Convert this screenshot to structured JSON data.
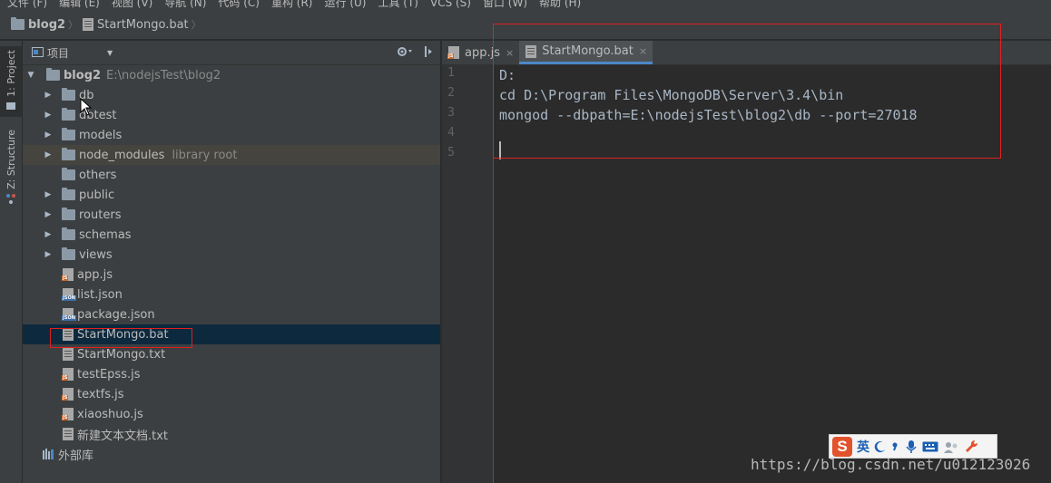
{
  "menu": [
    "文件 (F)",
    "编辑 (E)",
    "视图 (V)",
    "导航 (N)",
    "代码 (C)",
    "重构 (R)",
    "运行 (U)",
    "工具 (T)",
    "VCS (S)",
    "窗口 (W)",
    "帮助 (H)"
  ],
  "breadcrumb": {
    "project": "blog2",
    "file": "StartMongo.bat"
  },
  "side_tabs": {
    "project": "1: Project",
    "structure": "Z: Structure"
  },
  "project_panel": {
    "title": "项目"
  },
  "tree": {
    "root": {
      "name": "blog2",
      "path": "E:\\nodejsTest\\blog2"
    },
    "folders": [
      {
        "name": "db"
      },
      {
        "name": "dbtest"
      },
      {
        "name": "models"
      },
      {
        "name": "node_modules",
        "hint": "library root"
      },
      {
        "name": "others"
      },
      {
        "name": "public"
      },
      {
        "name": "routers"
      },
      {
        "name": "schemas"
      },
      {
        "name": "views"
      }
    ],
    "files": [
      {
        "name": "app.js",
        "type": "js"
      },
      {
        "name": "list.json",
        "type": "json"
      },
      {
        "name": "package.json",
        "type": "json"
      },
      {
        "name": "StartMongo.bat",
        "type": "plain"
      },
      {
        "name": "StartMongo.txt",
        "type": "plain"
      },
      {
        "name": "testEpss.js",
        "type": "js"
      },
      {
        "name": "textfs.js",
        "type": "js"
      },
      {
        "name": "xiaoshuo.js",
        "type": "js"
      },
      {
        "name": "新建文本文档.txt",
        "type": "plain"
      }
    ],
    "external_libs": "外部库"
  },
  "editor": {
    "tabs": [
      {
        "label": "app.js",
        "close": "×"
      },
      {
        "label": "StartMongo.bat",
        "close": "×"
      }
    ],
    "line_numbers": [
      "1",
      "2",
      "3",
      "4",
      "5"
    ],
    "lines": [
      "D:",
      "cd D:\\Program Files\\MongoDB\\Server\\3.4\\bin",
      "mongod --dbpath=E:\\nodejsTest\\blog2\\db --port=27018",
      "",
      ""
    ]
  },
  "ime": {
    "logo": "S",
    "lang": "英"
  },
  "watermark": "https://blog.csdn.net/u012123026",
  "colors": {
    "selection": "#0d293e",
    "accent_tab": "#4a88c7",
    "annotation": "#e02020"
  }
}
